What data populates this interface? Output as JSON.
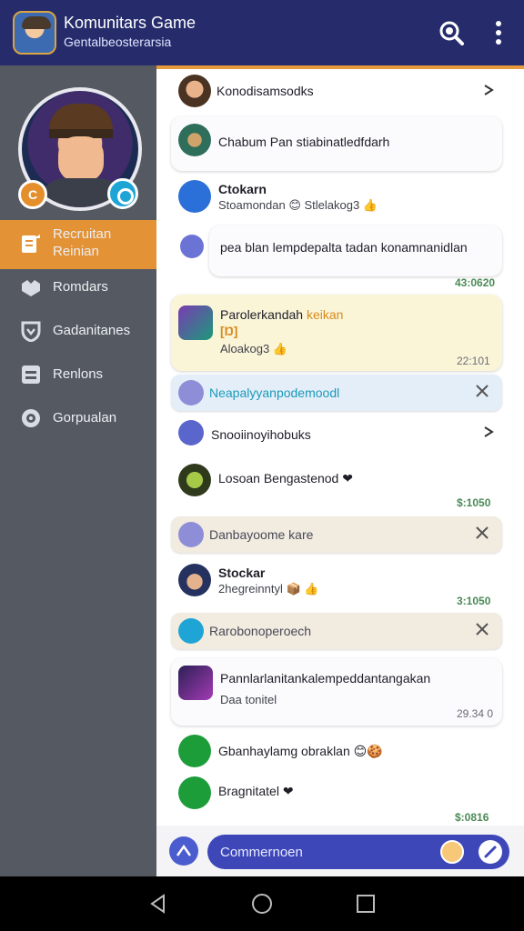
{
  "header": {
    "title": "Komunitars Game",
    "subtitle": "Gentalbeosterarsia",
    "search_icon": "search-icon",
    "more_icon": "more-vertical-icon"
  },
  "sidebar": {
    "profile_badge_left": "C",
    "items": [
      {
        "label": "Recruitan Reinian",
        "icon": "edit-icon",
        "active": true
      },
      {
        "label": "Romdars",
        "icon": "handshake-icon",
        "active": false
      },
      {
        "label": "Gadanitanes",
        "icon": "shield-icon",
        "active": false
      },
      {
        "label": "Renlons",
        "icon": "server-icon",
        "active": false
      },
      {
        "label": "Gorpualan",
        "icon": "target-icon",
        "active": false
      }
    ]
  },
  "feed": {
    "row1": {
      "text": "Konodisamsodks"
    },
    "row2": {
      "text": "Chabum Pan stiabinatledfdarh"
    },
    "row3": {
      "name": "Ctokarn",
      "sub": "Stoamondan 😊 Stlelakog3 👍"
    },
    "row4": {
      "text": "pea blan lempdepalta tadan konamnanidlan",
      "time": "43:0620"
    },
    "row5": {
      "text": "Parolerkandah",
      "highlight": "keikan",
      "tag": "[Ŋ]",
      "sub": "Aloakog3 👍",
      "time": "22:101"
    },
    "strip1": {
      "text": "Neapalyyanpodemoodl"
    },
    "row6": {
      "text": "Snooiinoyihobuks"
    },
    "row7": {
      "text": "Losoan Bengastenod ❤",
      "time": "$:1050"
    },
    "strip2": {
      "text": "Danbayoome kare"
    },
    "row8": {
      "name": "Stockar",
      "sub": "2hegreinntyl 📦 👍",
      "time": "3:1050"
    },
    "strip3": {
      "text": "Rarobonoperoech"
    },
    "row9": {
      "text": "Pannlarlanitankalempeddantangakan",
      "sub": "Daa tonitel",
      "time": "29.34 0"
    },
    "row10": {
      "text": "Gbanhaylamg obraklan 😊🍪"
    },
    "row11": {
      "text": "Bragnitatel ❤",
      "time": "$:0816"
    }
  },
  "composer": {
    "placeholder": "Commernoen",
    "emoji_label": "🙂"
  },
  "colors": {
    "header": "#262c6b",
    "accent": "#e39236",
    "sidebar": "#555a62",
    "composer": "#3d47b8"
  }
}
